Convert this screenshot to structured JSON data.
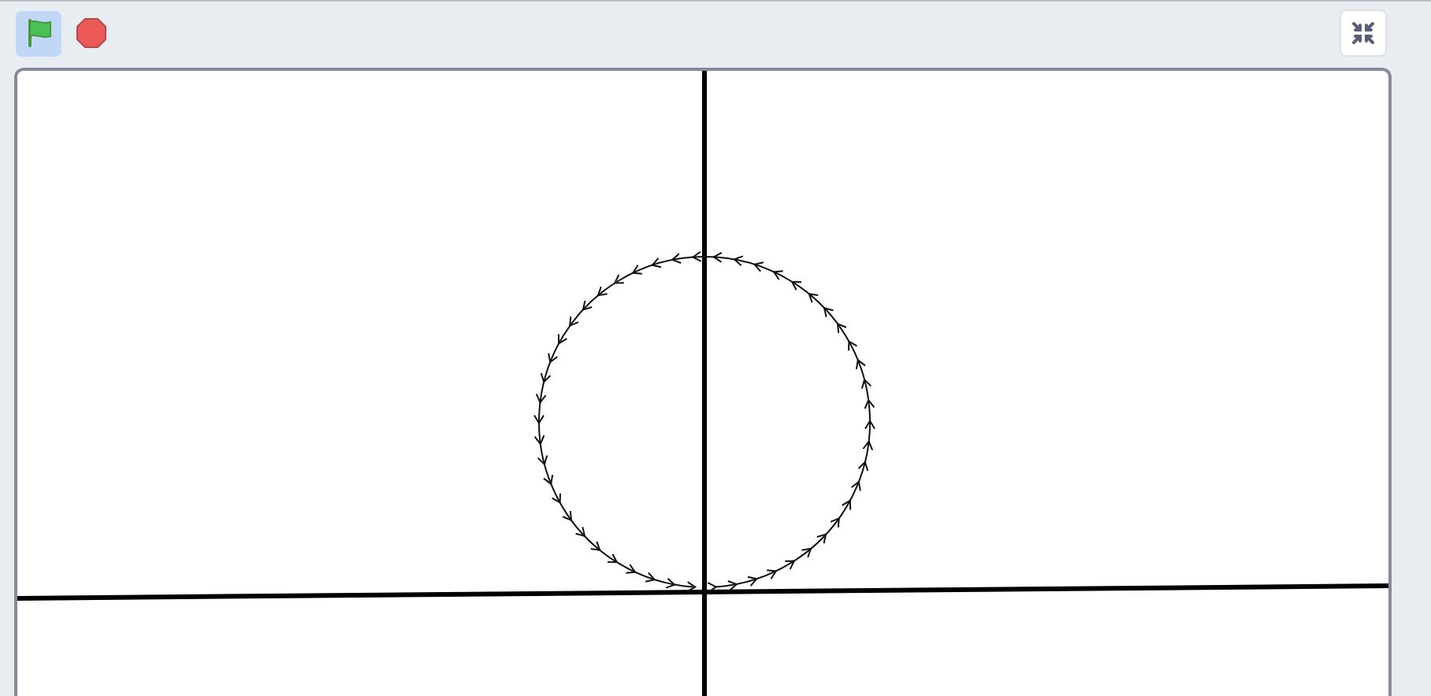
{
  "green_flag": {
    "active": true
  }
}
